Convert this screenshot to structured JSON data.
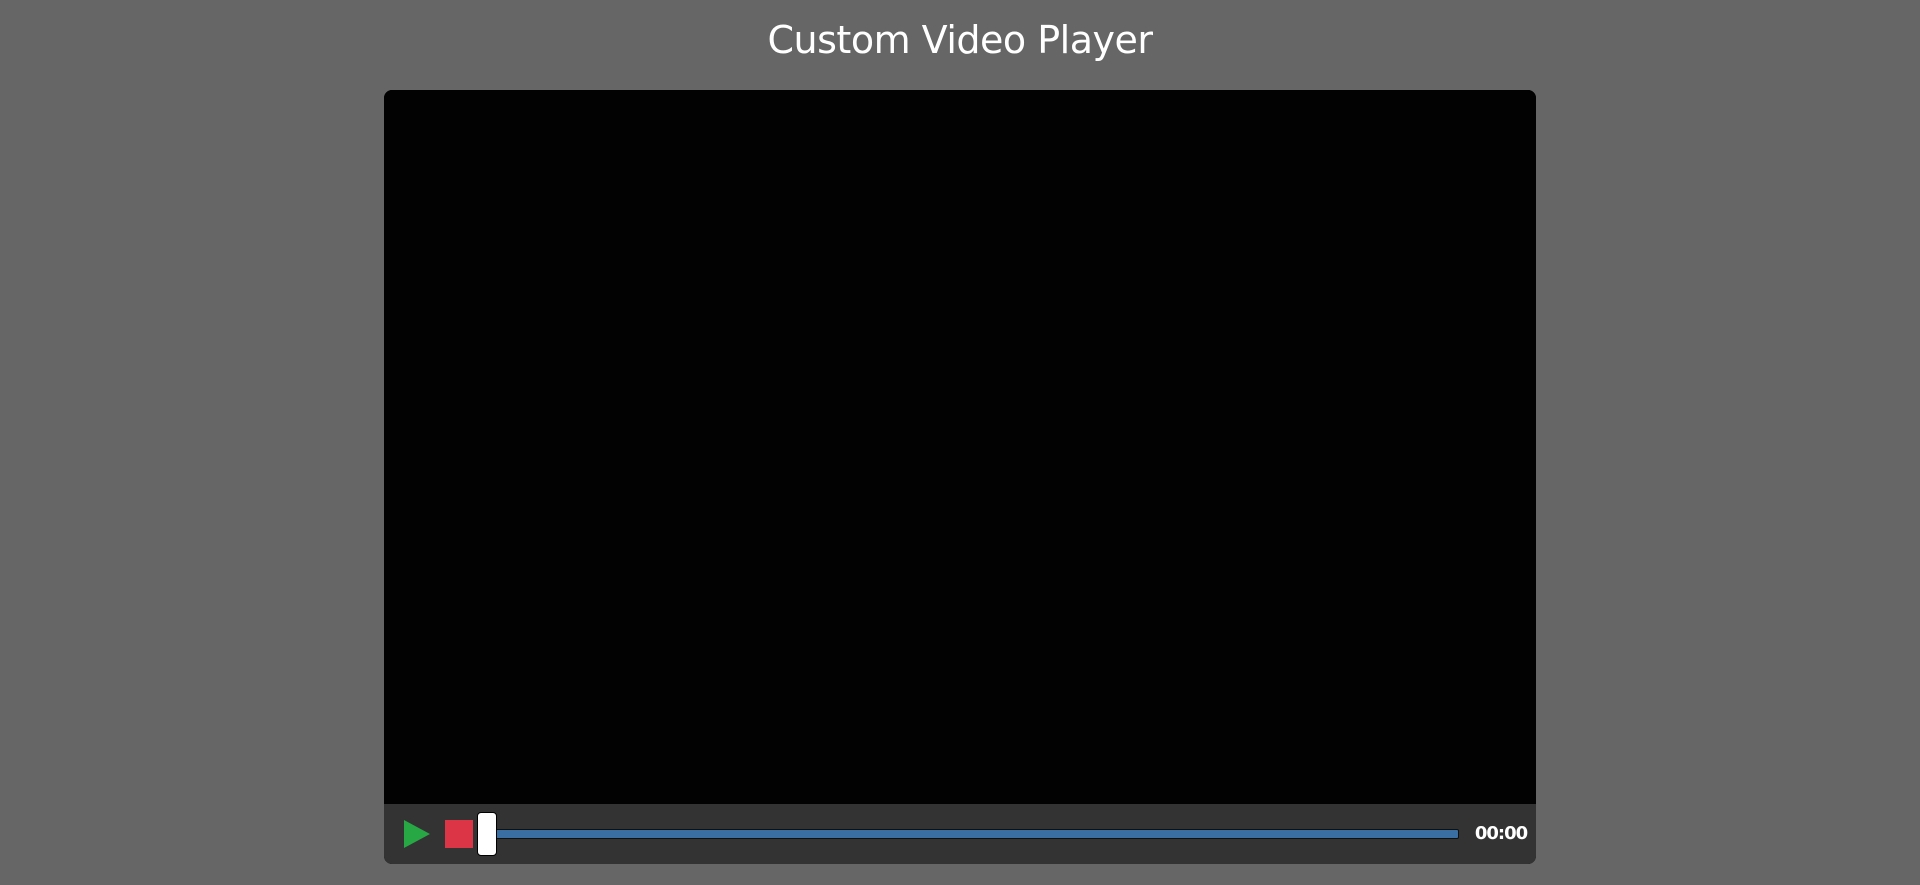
{
  "page": {
    "title": "Custom Video Player"
  },
  "player": {
    "controls": {
      "play_icon": "play-icon",
      "stop_icon": "stop-icon",
      "play_color": "#28a745",
      "stop_color": "#dc3545",
      "progress_color": "#3a6fa3",
      "progress_fraction": 0.0,
      "time_display": "00:00"
    }
  },
  "colors": {
    "background": "#666666",
    "controls_bar": "#333333",
    "video": "#020203"
  }
}
